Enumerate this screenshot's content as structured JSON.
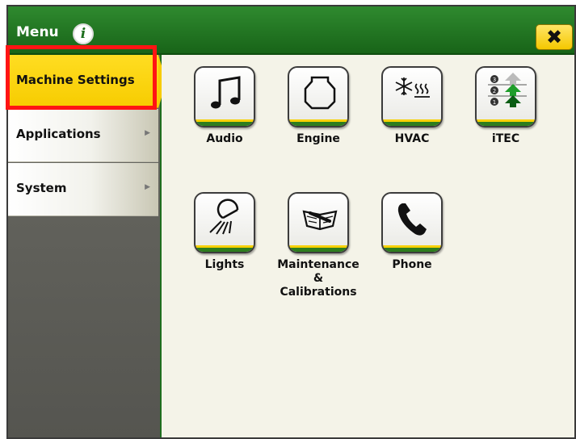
{
  "window": {
    "title": "Menu",
    "close_label": "✖"
  },
  "sidebar": {
    "items": [
      {
        "label": "Machine Settings",
        "active": true
      },
      {
        "label": "Applications",
        "highlighted": true
      },
      {
        "label": "System"
      }
    ]
  },
  "main": {
    "tiles": [
      {
        "label": "Audio",
        "icon": "music-note-icon"
      },
      {
        "label": "Engine",
        "icon": "engine-icon"
      },
      {
        "label": "HVAC",
        "icon": "hvac-icon"
      },
      {
        "label": "iTEC",
        "icon": "itec-icon"
      },
      {
        "label": "Lights",
        "icon": "light-icon"
      },
      {
        "label": "Maintenance\n&\nCalibrations",
        "icon": "maintenance-book-icon"
      },
      {
        "label": "Phone",
        "icon": "phone-icon"
      }
    ]
  },
  "colors": {
    "brand_green": "#1e6e1e",
    "active_yellow": "#f7cc00",
    "highlight_red": "#ff1414"
  }
}
